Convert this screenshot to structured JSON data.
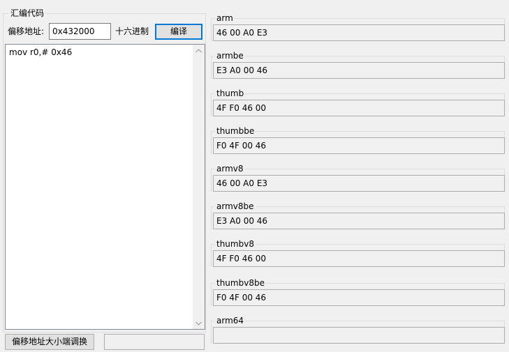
{
  "assemble": {
    "group_label": "汇编代码",
    "offset_label": "偏移地址:",
    "offset_value": "0x432000",
    "hex_label": "十六进制",
    "compile_label": "编译",
    "code": "mov r0,# 0x46"
  },
  "bottom": {
    "endian_button_label": "偏移地址大小端调换",
    "endian_output": ""
  },
  "outputs": [
    {
      "label": "arm",
      "value": "46 00 A0 E3"
    },
    {
      "label": "armbe",
      "value": "E3 A0 00 46"
    },
    {
      "label": "thumb",
      "value": "4F F0 46 00"
    },
    {
      "label": "thumbbe",
      "value": "F0 4F 00 46"
    },
    {
      "label": "armv8",
      "value": "46 00 A0 E3"
    },
    {
      "label": "armv8be",
      "value": "E3 A0 00 46"
    },
    {
      "label": "thumbv8",
      "value": "4F F0 46 00"
    },
    {
      "label": "thumbv8be",
      "value": "F0 4F 00 46"
    },
    {
      "label": "arm64",
      "value": ""
    }
  ]
}
